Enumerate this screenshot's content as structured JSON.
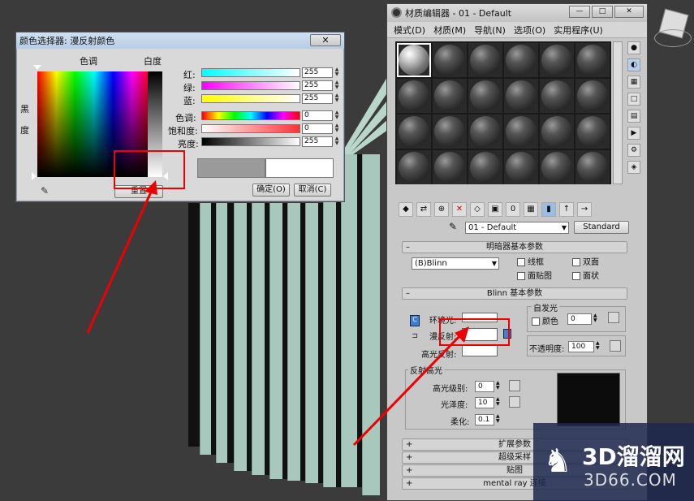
{
  "color_picker": {
    "title": "颜色选择器: 漫反射颜色",
    "close": "✕",
    "hue_label": "色调",
    "whiteness_label": "白度",
    "blackness_label": "黑度",
    "rows": [
      {
        "label": "红:",
        "value": "255"
      },
      {
        "label": "绿:",
        "value": "255"
      },
      {
        "label": "蓝:",
        "value": "255"
      },
      {
        "label": "色调:",
        "value": "0"
      },
      {
        "label": "饱和度:",
        "value": "0"
      },
      {
        "label": "亮度:",
        "value": "255"
      }
    ],
    "reset_label": "重置",
    "ok_label": "确定(O)",
    "cancel_label": "取消(C)"
  },
  "material_editor": {
    "title": "材质编辑器 - 01 - Default",
    "menu": [
      "模式(D)",
      "材质(M)",
      "导航(N)",
      "选项(O)",
      "实用程序(U)"
    ],
    "material_name": "01 - Default",
    "material_type": "Standard",
    "shader_rollout": "明暗器基本参数",
    "shader_type": "(B)Blinn",
    "shader_options": [
      "线框",
      "双面",
      "面贴图",
      "面状"
    ],
    "blinn_rollout": "Blinn 基本参数",
    "self_illum_label": "自发光",
    "color_label": "颜色",
    "self_illum_value": "0",
    "ambient_label": "环境光:",
    "diffuse_label": "漫反射:",
    "specular_label": "高光反射:",
    "opacity_label": "不透明度:",
    "opacity_value": "100",
    "spec_highlights_label": "反射高光",
    "spec_level_label": "高光级别:",
    "spec_level_value": "0",
    "glossiness_label": "光泽度:",
    "glossiness_value": "10",
    "soften_label": "柔化:",
    "soften_value": "0.1",
    "collapsed_rollouts": [
      "扩展参数",
      "超级采样",
      "贴图",
      "mental ray 连接"
    ]
  },
  "watermark": {
    "big": "3D溜溜网",
    "small": "3D66.COM"
  }
}
